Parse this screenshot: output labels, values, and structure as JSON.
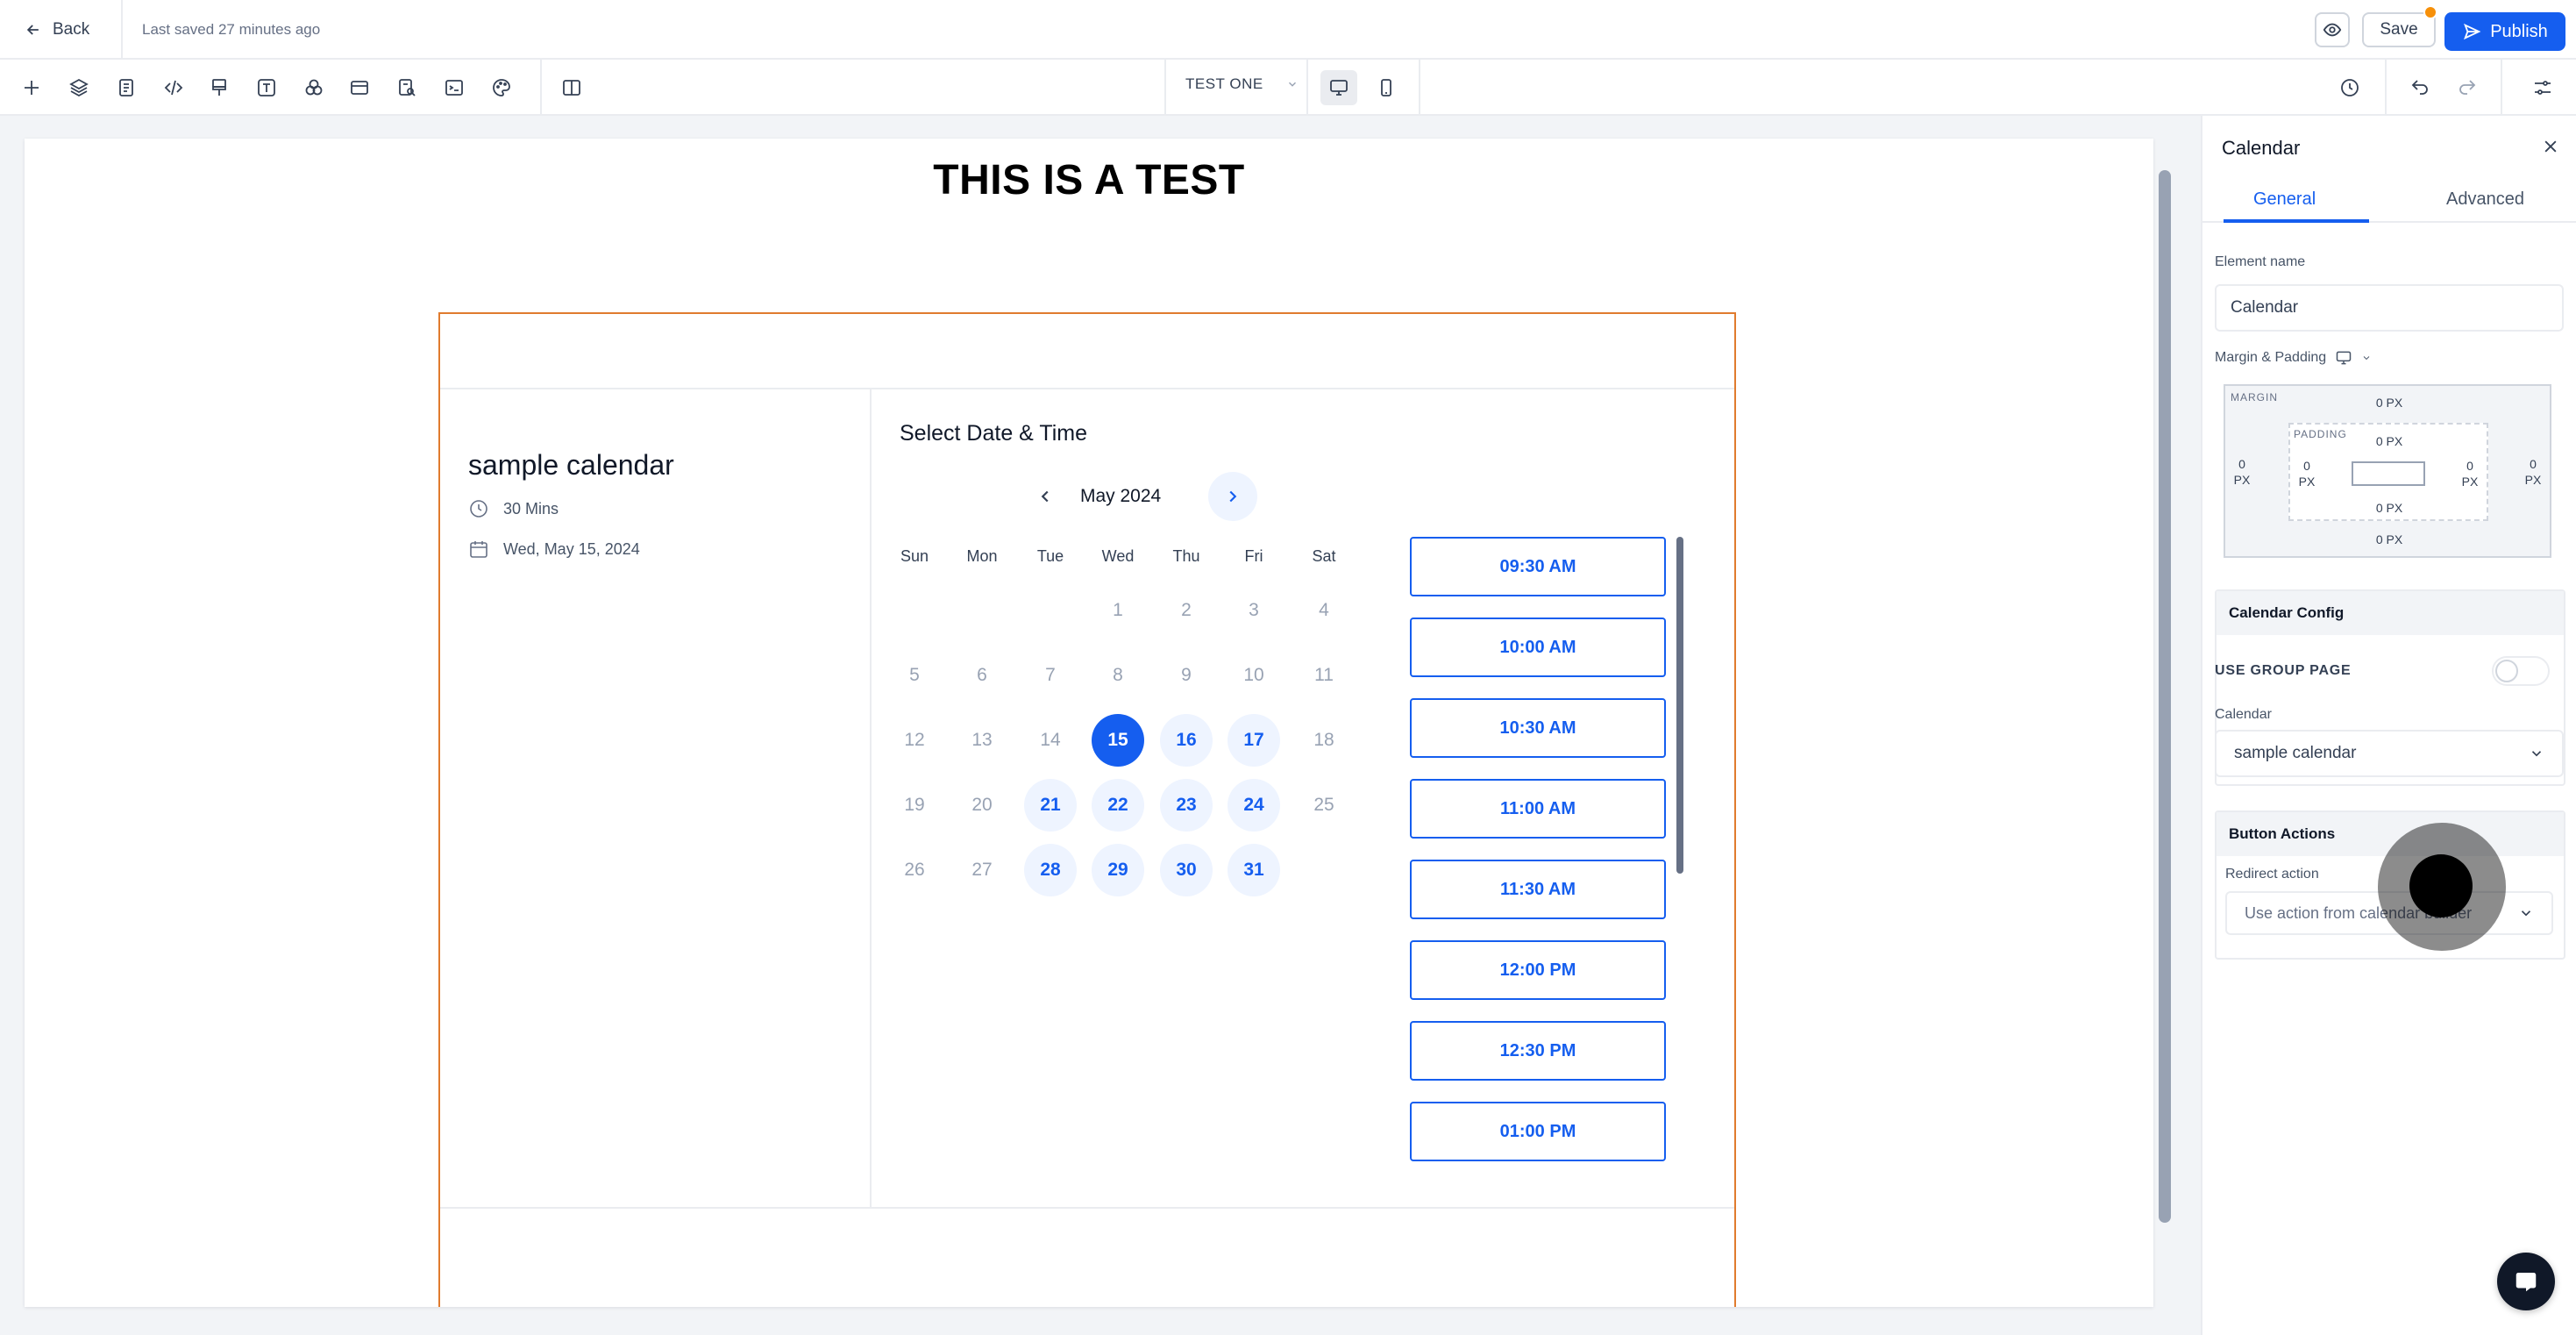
{
  "topbar": {
    "back_label": "Back",
    "last_saved": "Last saved 27 minutes ago",
    "save_label": "Save",
    "publish_label": "Publish"
  },
  "toolbar": {
    "tools": [
      "add-icon",
      "layers-icon",
      "pages-icon",
      "code-icon",
      "paint-icon",
      "text-icon",
      "shapes-icon",
      "section-icon",
      "search-page-icon",
      "terminal-icon",
      "palette-icon",
      "layout-icon"
    ],
    "page_name": "TEST ONE",
    "device": "desktop"
  },
  "canvas": {
    "heading": "THIS IS A TEST",
    "calendar": {
      "title": "sample calendar",
      "duration": "30 Mins",
      "date": "Wed, May 15, 2024",
      "select_title": "Select Date & Time",
      "month": "May 2024",
      "weekdays": [
        "Sun",
        "Mon",
        "Tue",
        "Wed",
        "Thu",
        "Fri",
        "Sat"
      ],
      "weeks": [
        [
          "",
          "",
          "",
          "1",
          "2",
          "3",
          "4"
        ],
        [
          "5",
          "6",
          "7",
          "8",
          "9",
          "10",
          "11"
        ],
        [
          "12",
          "13",
          "14",
          "15",
          "16",
          "17",
          "18"
        ],
        [
          "19",
          "20",
          "21",
          "22",
          "23",
          "24",
          "25"
        ],
        [
          "26",
          "27",
          "28",
          "29",
          "30",
          "31",
          ""
        ]
      ],
      "selected_day": "15",
      "available_days": [
        "16",
        "17",
        "21",
        "22",
        "23",
        "24",
        "28",
        "29",
        "30",
        "31"
      ],
      "time_slots": [
        "09:30 AM",
        "10:00 AM",
        "10:30 AM",
        "11:00 AM",
        "11:30 AM",
        "12:00 PM",
        "12:30 PM",
        "01:00 PM"
      ]
    }
  },
  "panel": {
    "title": "Calendar",
    "tabs": [
      "General",
      "Advanced"
    ],
    "active_tab": "General",
    "element_name_label": "Element name",
    "element_name_value": "Calendar",
    "margin_padding_label": "Margin & Padding",
    "margin_label": "MARGIN",
    "padding_label": "PADDING",
    "margin": {
      "top": "0",
      "right": "0",
      "bottom": "0",
      "left": "0"
    },
    "padding": {
      "top": "0",
      "right": "0",
      "bottom": "0",
      "left": "0"
    },
    "unit": "PX",
    "calendar_config_title": "Calendar Config",
    "use_group_page_label": "USE GROUP PAGE",
    "use_group_page_on": false,
    "calendar_label": "Calendar",
    "calendar_value": "sample calendar",
    "button_actions_title": "Button Actions",
    "redirect_label": "Redirect action",
    "redirect_value": "Use action from calendar builder"
  },
  "colors": {
    "accent": "#155eef",
    "accent_light": "#eef4ff",
    "section_border": "#e07b2e",
    "unsaved_dot": "#f79009"
  }
}
